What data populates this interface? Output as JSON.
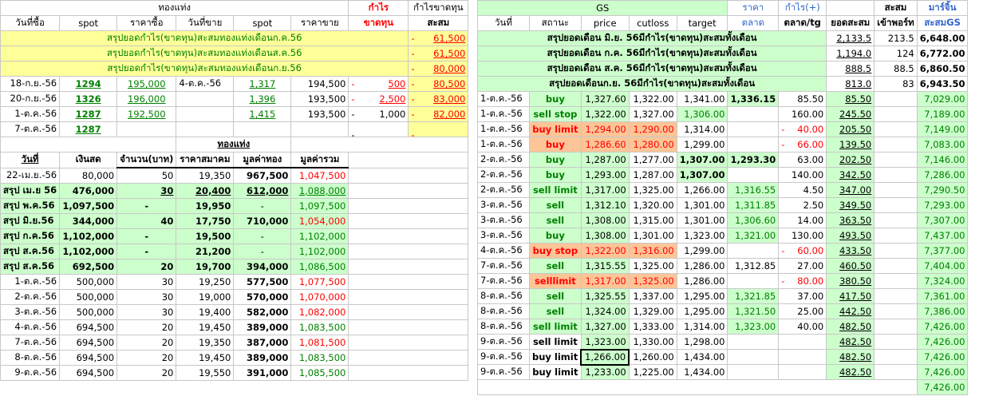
{
  "left": {
    "group1": "ทองแท่ง",
    "profit_label": "กำไร",
    "profit_loss_label": "กำไรขาดทุน",
    "hdr": [
      "วันที่ซื้อ",
      "spot",
      "ราคาซื้อ",
      "วันที่ขาย",
      "spot",
      "ราคาขาย",
      "ขาดทุน",
      "สะสม"
    ],
    "summaries": [
      {
        "label": "สรุปยอดกำไร(ขาดทุน)สะสมทองแท่งเดือนก.ค.56",
        "value": "61,500"
      },
      {
        "label": "สรุปยอดกำไร(ขาดทุน)สะสมทองแท่งเดือนส.ค.56",
        "value": "61,500"
      },
      {
        "label": "สรุปยอดกำไร(ขาดทุน)สะสมทองแท่งเดือนก.ย.56",
        "value": "80,000"
      }
    ],
    "trades": [
      {
        "buy_date": "18-ก.ย.-56",
        "spot": "1294",
        "buy_price": "195,000",
        "sell_date": "4-ต.ค.-56",
        "sell_spot": "1,317",
        "sell_price": "194,500",
        "pl": "500",
        "cum": "80,500"
      },
      {
        "buy_date": "20-ก.ย.-56",
        "spot": "1326",
        "buy_price": "196,000",
        "sell_date": "",
        "sell_spot": "1,396",
        "sell_price": "193,500",
        "pl": "2,500",
        "cum": "83,000"
      },
      {
        "buy_date": "1-ต.ค.-56",
        "spot": "1287",
        "buy_price": "192,500",
        "sell_date": "",
        "sell_spot": "1,415",
        "sell_price": "193,500",
        "pl": "1,000",
        "cum": "82,000"
      },
      {
        "buy_date": "7-ต.ค.-56",
        "spot": "1287",
        "buy_price": "",
        "sell_date": "",
        "sell_spot": "",
        "sell_price": "",
        "pl": "",
        "cum": ""
      }
    ],
    "group2": "ทองแท่ง",
    "hdr2": [
      "วันที่",
      "เงินสด",
      "จำนวน(บาท)",
      "ราคาสมาคม",
      "มูลค่าทอง",
      "มูลค่ารวม"
    ],
    "holdings": [
      {
        "date": "22-เม.ย.-56",
        "cash": "80,000",
        "qty": "50",
        "price": "19,350",
        "gold": "967,500",
        "total": "1,047,500"
      },
      {
        "date": "สรุป เม.ย 56",
        "cash": "476,000",
        "qty": "30",
        "price": "20,400",
        "gold": "612,000",
        "total": "1,088,000"
      },
      {
        "date": "สรุป พ.ค.56",
        "cash": "1,097,500",
        "qty": "-",
        "price": "19,950",
        "gold": "-",
        "total": "1,097,500"
      },
      {
        "date": "สรุป มิ.ย.56",
        "cash": "344,000",
        "qty": "40",
        "price": "17,750",
        "gold": "710,000",
        "total": "1,054,000"
      },
      {
        "date": "สรุป ก.ค.56",
        "cash": "1,102,000",
        "qty": "-",
        "price": "19,500",
        "gold": "-",
        "total": "1,102,000"
      },
      {
        "date": "สรุป ส.ค.56",
        "cash": "1,102,000",
        "qty": "-",
        "price": "21,200",
        "gold": "-",
        "total": "1,102,000"
      },
      {
        "date": "สรุป ส.ค.56",
        "cash": "692,500",
        "qty": "20",
        "price": "19,700",
        "gold": "394,000",
        "total": "1,086,500"
      },
      {
        "date": "1-ต.ค.-56",
        "cash": "500,000",
        "qty": "30",
        "price": "19,250",
        "gold": "577,500",
        "total": "1,077,500"
      },
      {
        "date": "2-ต.ค.-56",
        "cash": "500,000",
        "qty": "30",
        "price": "19,000",
        "gold": "570,000",
        "total": "1,070,000"
      },
      {
        "date": "3-ต.ค.-56",
        "cash": "500,000",
        "qty": "30",
        "price": "19,400",
        "gold": "582,000",
        "total": "1,082,000"
      },
      {
        "date": "4-ต.ค.-56",
        "cash": "694,500",
        "qty": "20",
        "price": "19,450",
        "gold": "389,000",
        "total": "1,083,500"
      },
      {
        "date": "7-ต.ค.-56",
        "cash": "694,500",
        "qty": "20",
        "price": "19,350",
        "gold": "387,000",
        "total": "1,081,500"
      },
      {
        "date": "8-ต.ค.-56",
        "cash": "694,500",
        "qty": "20",
        "price": "19,450",
        "gold": "389,000",
        "total": "1,083,500"
      },
      {
        "date": "9-ต.ค.-56",
        "cash": "694,500",
        "qty": "20",
        "price": "19,550",
        "gold": "391,000",
        "total": "1,085,500"
      }
    ]
  },
  "right": {
    "gs": "GS",
    "market_price": "ราคา",
    "profit_plus": "กำไร(+)",
    "accum": "สะสม",
    "margin": "มาร์จิ้น",
    "hdr": [
      "วันที่",
      "สถานะ",
      "price",
      "cutloss",
      "target",
      "ตลาด",
      "ตลาด/tg",
      "ยอดสะสม",
      "เข้าพอร์ท",
      "สะสมGS"
    ],
    "summaries": [
      {
        "label": "สรุปยอดเดือน มิ.ย. 56มีกำไร(ขาดทุน)สะสมทั้งเดือน",
        "cum": "2,133.5",
        "port": "213.5",
        "gs": "6,648.00"
      },
      {
        "label": "สรุปยอดเดือน ก.ค. 56มีกำไร(ขาดทุน)สะสมทั้งเดือน",
        "cum": "1,194.0",
        "port": "124",
        "gs": "6,772.00"
      },
      {
        "label": "สรุปยอดเดือน ส.ค. 56มีกำไร(ขาดทุน)สะสมทั้งเดือน",
        "cum": "888.5",
        "port": "88.5",
        "gs": "6,860.50"
      },
      {
        "label": "สรุปยอดเดือนก.ย. 56มีกำไร(ขาดทุน)สะสมทั้งเดือน",
        "cum": "813.0",
        "port": "83",
        "gs": "6,943.50"
      }
    ],
    "rows": [
      {
        "date": "1-ต.ค.-56",
        "status": "buy",
        "price": "1,327.60",
        "cutloss": "1,322.00",
        "target": "1,341.00",
        "market": "1,336.15",
        "mtg": "85.50",
        "cum": "85.50",
        "gs": "7,029.00"
      },
      {
        "date": "1-ต.ค.-56",
        "status": "sell stop",
        "price": "1,322.00",
        "cutloss": "1,327.00",
        "target": "1,306.00",
        "market": "",
        "mtg": "160.00",
        "cum": "245.50",
        "gs": "7,189.00"
      },
      {
        "date": "1-ต.ค.-56",
        "status": "buy limit",
        "price": "1,294.00",
        "cutloss": "1,290.00",
        "target": "1,314.00",
        "market": "",
        "mtg": "40.00",
        "cum": "205.50",
        "gs": "7,149.00"
      },
      {
        "date": "1-ต.ค.-56",
        "status": "buy",
        "price": "1,286.60",
        "cutloss": "1,280.00",
        "target": "1,299.00",
        "market": "",
        "mtg": "66.00",
        "cum": "139.50",
        "gs": "7,083.00"
      },
      {
        "date": "2-ต.ค.-56",
        "status": "buy",
        "price": "1,287.00",
        "cutloss": "1,277.00",
        "target": "1,307.00",
        "market": "1,293.30",
        "mtg": "63.00",
        "cum": "202.50",
        "gs": "7,146.00"
      },
      {
        "date": "2-ต.ค.-56",
        "status": "buy",
        "price": "1,293.00",
        "cutloss": "1,287.00",
        "target": "1,307.00",
        "market": "",
        "mtg": "140.00",
        "cum": "342.50",
        "gs": "7,286.00"
      },
      {
        "date": "2-ต.ค.-56",
        "status": "sell limit",
        "price": "1,317.00",
        "cutloss": "1,325.00",
        "target": "1,266.00",
        "market": "1,316.55",
        "mtg": "4.50",
        "cum": "347.00",
        "gs": "7,290.50"
      },
      {
        "date": "3-ต.ค.-56",
        "status": "sell",
        "price": "1,312.10",
        "cutloss": "1,320.00",
        "target": "1,301.00",
        "market": "1,311.85",
        "mtg": "2.50",
        "cum": "349.50",
        "gs": "7,293.00"
      },
      {
        "date": "3-ต.ค.-56",
        "status": "sell",
        "price": "1,308.00",
        "cutloss": "1,315.00",
        "target": "1,301.00",
        "market": "1,306.60",
        "mtg": "14.00",
        "cum": "363.50",
        "gs": "7,307.00"
      },
      {
        "date": "3-ต.ค.-56",
        "status": "buy",
        "price": "1,308.00",
        "cutloss": "1,301.00",
        "target": "1,323.00",
        "market": "1,321.00",
        "mtg": "130.00",
        "cum": "493.50",
        "gs": "7,437.00"
      },
      {
        "date": "4-ต.ค.-56",
        "status": "buy stop",
        "price": "1,322.00",
        "cutloss": "1,316.00",
        "target": "1,299.00",
        "market": "",
        "mtg": "60.00",
        "cum": "433.50",
        "gs": "7,377.00"
      },
      {
        "date": "7-ต.ค.-56",
        "status": "sell",
        "price": "1,315.55",
        "cutloss": "1,325.00",
        "target": "1,286.00",
        "market": "1,312.85",
        "mtg": "27.00",
        "cum": "460.50",
        "gs": "7,404.00"
      },
      {
        "date": "7-ต.ค.-56",
        "status": "selllimit",
        "price": "1,317.00",
        "cutloss": "1,325.00",
        "target": "1,286.00",
        "market": "",
        "mtg": "80.00",
        "cum": "380.50",
        "gs": "7,324.00"
      },
      {
        "date": "8-ต.ค.-56",
        "status": "sell",
        "price": "1,325.55",
        "cutloss": "1,337.00",
        "target": "1,295.00",
        "market": "1,321.85",
        "mtg": "37.00",
        "cum": "417.50",
        "gs": "7,361.00"
      },
      {
        "date": "8-ต.ค.-56",
        "status": "sell",
        "price": "1,324.00",
        "cutloss": "1,329.00",
        "target": "1,295.00",
        "market": "1,321.50",
        "mtg": "25.00",
        "cum": "442.50",
        "gs": "7,386.00"
      },
      {
        "date": "8-ต.ค.-56",
        "status": "sell limit",
        "price": "1,327.00",
        "cutloss": "1,333.00",
        "target": "1,314.00",
        "market": "1,323.00",
        "mtg": "40.00",
        "cum": "482.50",
        "gs": "7,426.00"
      },
      {
        "date": "9-ต.ค.-56",
        "status": "sell limit",
        "price": "1,323.00",
        "cutloss": "1,330.00",
        "target": "1,298.00",
        "market": "",
        "mtg": "",
        "cum": "482.50",
        "gs": "7,426.00"
      },
      {
        "date": "9-ต.ค.-56",
        "status": "buy limit",
        "price": "1,266.00",
        "cutloss": "1,260.00",
        "target": "1,434.00",
        "market": "",
        "mtg": "",
        "cum": "482.50",
        "gs": "7,426.00"
      },
      {
        "date": "9-ต.ค.-56",
        "status": "buy limit",
        "price": "1,233.00",
        "cutloss": "1,225.00",
        "target": "1,434.00",
        "market": "",
        "mtg": "",
        "cum": "482.50",
        "gs": "7,426.00"
      }
    ],
    "final_gs": "7,426.00"
  }
}
